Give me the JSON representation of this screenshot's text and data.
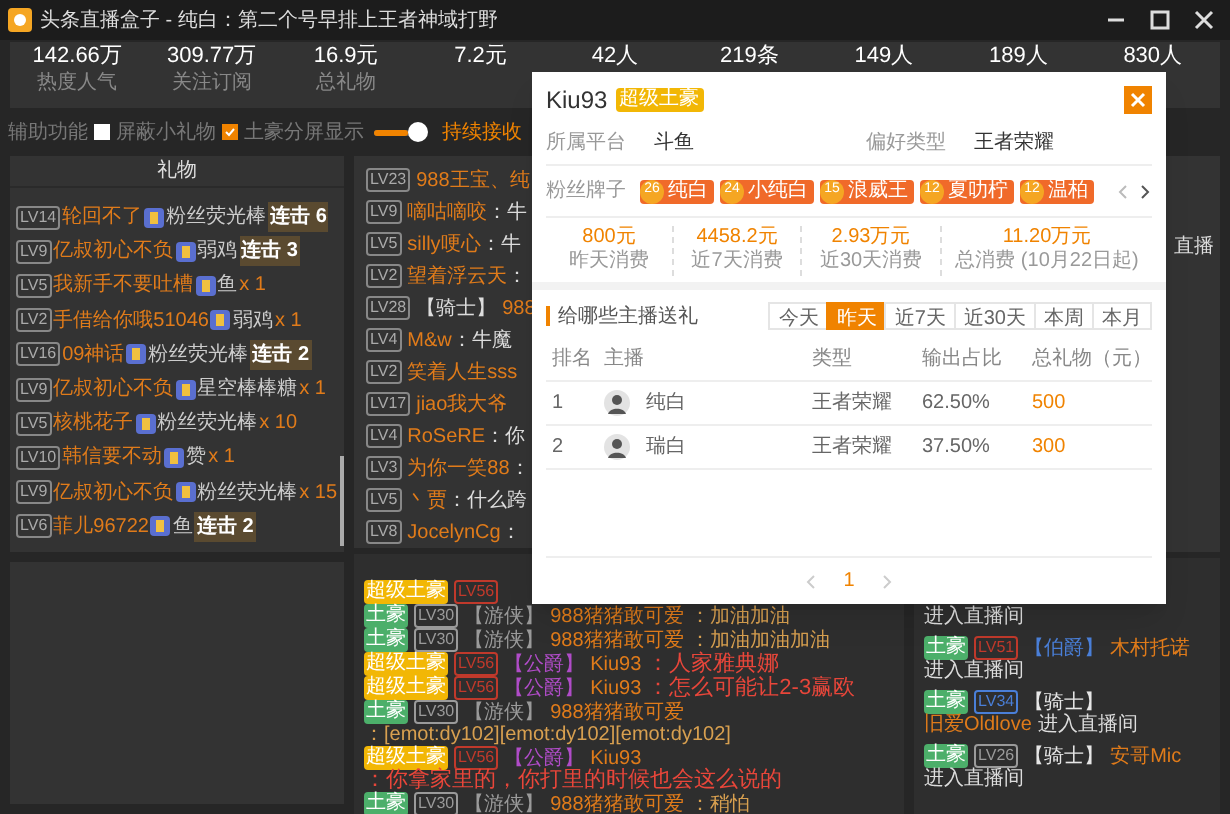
{
  "window": {
    "title": "头条直播盒子 - 纯白：第二个号早排上王者神域打野"
  },
  "stats": [
    {
      "value": "142.66万",
      "label": "热度人气"
    },
    {
      "value": "309.77万",
      "label": "关注订阅"
    },
    {
      "value": "16.9元",
      "label": "总礼物"
    },
    {
      "value": "7.2元"
    },
    {
      "value": "42人"
    },
    {
      "value": "219条"
    },
    {
      "value": "149人"
    },
    {
      "value": "189人"
    },
    {
      "value": "830人"
    }
  ],
  "options": {
    "label": "辅助功能",
    "toggles": [
      {
        "label": "屏蔽小礼物",
        "checked": false
      },
      {
        "label": "土豪分屏显示",
        "checked": true
      }
    ],
    "slider": {
      "level": 0.85
    },
    "slider_label": "持续接收"
  },
  "gift_panel": {
    "title": "礼物",
    "rows": [
      {
        "level": "LV14",
        "user": "轮回不了",
        "gift": "粉丝荧光棒",
        "kind": "combo",
        "count": "连击 6"
      },
      {
        "level": "LV9",
        "user": "亿叔初心不负",
        "gift": "弱鸡",
        "kind": "combo",
        "count": "连击 3"
      },
      {
        "level": "LV5",
        "user": "我新手不要吐槽",
        "gift": "鱼",
        "kind": "times",
        "count": "x 1"
      },
      {
        "level": "LV2",
        "user": "手借给你哦51046",
        "gift": "弱鸡",
        "kind": "times",
        "count": "x 1"
      },
      {
        "level": "LV16",
        "user": "09神话",
        "gift": "粉丝荧光棒",
        "kind": "combo",
        "count": "连击 2"
      },
      {
        "level": "LV9",
        "user": "亿叔初心不负",
        "gift": "星空棒棒糖",
        "kind": "times",
        "count": "x 1"
      },
      {
        "level": "LV5",
        "user": "核桃花子",
        "gift": "粉丝荧光棒",
        "kind": "times",
        "count": "x 10"
      },
      {
        "level": "LV10",
        "user": "韩信要不动",
        "gift": "赞",
        "kind": "times",
        "count": "x 1"
      },
      {
        "level": "LV9",
        "user": "亿叔初心不负",
        "gift": "粉丝荧光棒",
        "kind": "times",
        "count": "x 15"
      },
      {
        "level": "LV6",
        "user": "菲儿96722",
        "gift": "鱼",
        "kind": "combo",
        "count": "连击 2"
      }
    ]
  },
  "chat": {
    "rows": [
      {
        "level": "LV23",
        "user": "988王宝、纯"
      },
      {
        "level": "LV9",
        "user": "嘀咕嘀咬",
        "message": "：牛"
      },
      {
        "level": "LV5",
        "user": "silly哽心",
        "message": "：牛"
      },
      {
        "level": "LV2",
        "user": "望着浮云天",
        "message": "："
      },
      {
        "level": "LV28",
        "title": "【骑士】",
        "user": "988"
      },
      {
        "level": "LV4",
        "user": "M&w",
        "message": "：牛魔"
      },
      {
        "level": "LV2",
        "user": "笑着人生sss"
      },
      {
        "level": "LV17",
        "user": "jiao我大爷"
      },
      {
        "level": "LV4",
        "user": "RoSeRE",
        "message": "：你"
      },
      {
        "level": "LV3",
        "user": "为你一笑88",
        "message": "："
      },
      {
        "level": "LV5",
        "user": "丶贾",
        "message": "：什么跨"
      },
      {
        "level": "LV8",
        "user": "JocelynCg",
        "message": "："
      }
    ]
  },
  "vip_chat": {
    "rows": [
      {
        "tier": {
          "label": "超级土豪",
          "color": "#f2b705"
        },
        "level": {
          "label": "LV56",
          "color": "#c0392b"
        }
      },
      {
        "tier": {
          "label": "土豪",
          "color": "#4caf6a"
        },
        "level": {
          "label": "LV30",
          "color": "#9a9a9a"
        },
        "title": {
          "label": "【游侠】",
          "color": "#9a9a9a"
        },
        "user": "988猪猪敢可爱",
        "message": "：加油加油",
        "highlight": false
      },
      {
        "tier": {
          "label": "土豪",
          "color": "#4caf6a"
        },
        "level": {
          "label": "LV30",
          "color": "#9a9a9a"
        },
        "title": {
          "label": "【游侠】",
          "color": "#9a9a9a"
        },
        "user": "988猪猪敢可爱",
        "message": "：加油加油加油",
        "highlight": false
      },
      {
        "tier": {
          "label": "超级土豪",
          "color": "#f2b705"
        },
        "level": {
          "label": "LV56",
          "color": "#c0392b"
        },
        "title": {
          "label": "【公爵】",
          "color": "#b04cc8"
        },
        "user": "Kiu93",
        "message": "：人家雅典娜",
        "highlight": true
      },
      {
        "tier": {
          "label": "超级土豪",
          "color": "#f2b705"
        },
        "level": {
          "label": "LV56",
          "color": "#c0392b"
        },
        "title": {
          "label": "【公爵】",
          "color": "#b04cc8"
        },
        "user": "Kiu93",
        "message": "：怎么可能让2-3赢欧",
        "highlight": true
      },
      {
        "tier": {
          "label": "土豪",
          "color": "#4caf6a"
        },
        "level": {
          "label": "LV30",
          "color": "#9a9a9a"
        },
        "title": {
          "label": "【游侠】",
          "color": "#9a9a9a"
        },
        "user": "988猪猪敢可爱",
        "message": "：[emot:dy102][emot:dy102][emot:dy102]",
        "highlight": false
      },
      {
        "tier": {
          "label": "超级土豪",
          "color": "#f2b705"
        },
        "level": {
          "label": "LV56",
          "color": "#c0392b"
        },
        "title": {
          "label": "【公爵】",
          "color": "#b04cc8"
        },
        "user": "Kiu93",
        "message": "：你拿家里的，你打里的时候也会这么说的",
        "highlight": true
      },
      {
        "tier": {
          "label": "土豪",
          "color": "#4caf6a"
        },
        "level": {
          "label": "LV30",
          "color": "#9a9a9a"
        },
        "title": {
          "label": "【游侠】",
          "color": "#9a9a9a"
        },
        "user": "988猪猪敢可爱",
        "message": "：稍怕",
        "highlight": false
      }
    ]
  },
  "side_panel": {
    "text": "直播"
  },
  "entries": {
    "rows": [
      {
        "action": "进入直播间"
      },
      {
        "tier": {
          "label": "土豪",
          "color": "#4caf6a"
        },
        "level": {
          "label": "LV51",
          "color": "#c0392b"
        },
        "title": {
          "label": "【伯爵】",
          "color": "#4a7fd8"
        },
        "user": "木村托诺",
        "action": "进入直播间"
      },
      {
        "tier": {
          "label": "土豪",
          "color": "#4caf6a"
        },
        "level": {
          "label": "LV34",
          "color": "#4a7fd8"
        },
        "title": {
          "label": "【骑士】",
          "color": "#e6e6e6"
        },
        "user": "旧爱Oldlove",
        "action": "进入直播间"
      },
      {
        "tier": {
          "label": "土豪",
          "color": "#4caf6a"
        },
        "level": {
          "label": "LV26",
          "color": "#9a9a9a"
        },
        "title": {
          "label": "【骑士】",
          "color": "#e6e6e6"
        },
        "user": "安哥Mic",
        "action": "进入直播间"
      }
    ]
  },
  "modal": {
    "user": "Kiu93",
    "badge": "超级土豪",
    "platform_label": "所属平台",
    "platform": "斗鱼",
    "pref_label": "偏好类型",
    "pref": "王者荣耀",
    "fan_label": "粉丝牌子",
    "fan_badges": [
      {
        "level": "26",
        "name": "纯白"
      },
      {
        "level": "24",
        "name": "小纯白"
      },
      {
        "level": "15",
        "name": "浪威王"
      },
      {
        "level": "12",
        "name": "夏叻柠"
      },
      {
        "level": "12",
        "name": "温柏"
      }
    ],
    "spend": [
      {
        "value": "800元",
        "label": "昨天消费"
      },
      {
        "value": "4458.2元",
        "label": "近7天消费"
      },
      {
        "value": "2.93万元",
        "label": "近30天消费"
      },
      {
        "value": "11.20万元",
        "label": "总消费 (10月22日起)"
      }
    ],
    "section_title": "给哪些主播送礼",
    "tabs": [
      {
        "label": "今天",
        "selected": false
      },
      {
        "label": "昨天",
        "selected": true
      },
      {
        "label": "近7天",
        "selected": false
      },
      {
        "label": "近30天",
        "selected": false
      },
      {
        "label": "本周",
        "selected": false
      },
      {
        "label": "本月",
        "selected": false
      }
    ],
    "table": {
      "columns": [
        "排名",
        "主播",
        "类型",
        "输出占比",
        "总礼物（元）"
      ],
      "rows": [
        {
          "rank": "1",
          "name": "纯白",
          "type": "王者荣耀",
          "share": "62.50%",
          "total": "500"
        },
        {
          "rank": "2",
          "name": "瑞白",
          "type": "王者荣耀",
          "share": "37.50%",
          "total": "300"
        }
      ]
    },
    "pagination": {
      "page": "1"
    }
  }
}
